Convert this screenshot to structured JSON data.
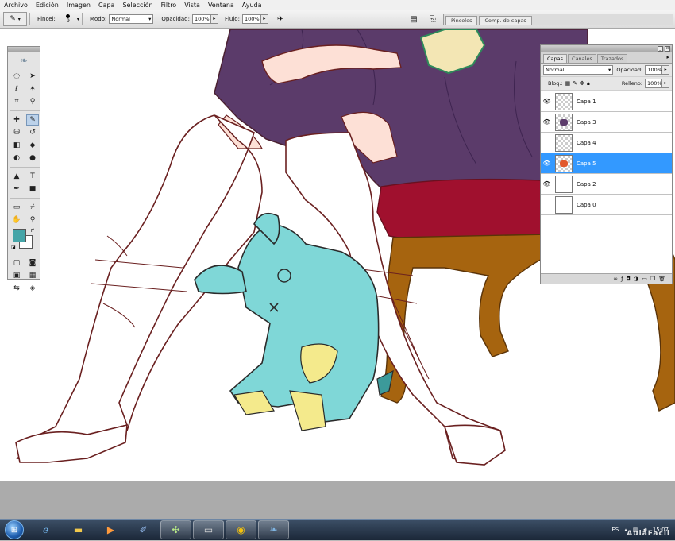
{
  "menu": [
    "Archivo",
    "Edición",
    "Imagen",
    "Capa",
    "Selección",
    "Filtro",
    "Vista",
    "Ventana",
    "Ayuda"
  ],
  "options": {
    "pincel_label": "Pincel:",
    "brush_size": "9",
    "modo_label": "Modo:",
    "modo_value": "Normal",
    "opacidad_label": "Opacidad:",
    "opacidad_value": "100%",
    "flujo_label": "Flujo:",
    "flujo_value": "100%",
    "well_tabs": [
      "Pinceles",
      "Comp. de capas"
    ]
  },
  "toolbox": {
    "foreground_color": "#45a5a8",
    "background_color": "#ffffff"
  },
  "layers_panel": {
    "tabs": [
      "Capas",
      "Canales",
      "Trazados"
    ],
    "blend_mode": "Normal",
    "opacity_label": "Opacidad:",
    "opacity_value": "100%",
    "lock_label": "Bloq.:",
    "fill_label": "Relleno:",
    "fill_value": "100%",
    "layers": [
      {
        "name": "Capa 1",
        "visible": true,
        "selected": false
      },
      {
        "name": "Capa 3",
        "visible": true,
        "selected": false
      },
      {
        "name": "Capa 4",
        "visible": false,
        "selected": false
      },
      {
        "name": "Capa 5",
        "visible": true,
        "selected": true
      },
      {
        "name": "Capa 2",
        "visible": true,
        "selected": false
      },
      {
        "name": "Capa 0",
        "visible": false,
        "selected": false
      }
    ]
  },
  "taskbar": {
    "language": "ES",
    "time": "15:07"
  },
  "watermark": "AulaFacil",
  "colors": {
    "accent_selected": "#3399ff",
    "dress_purple": "#5b3b6a",
    "cushion_red": "#a0102e",
    "chair_brown": "#a6640f",
    "bunny_teal": "#7fd7d7",
    "outline": "#6a2020"
  }
}
